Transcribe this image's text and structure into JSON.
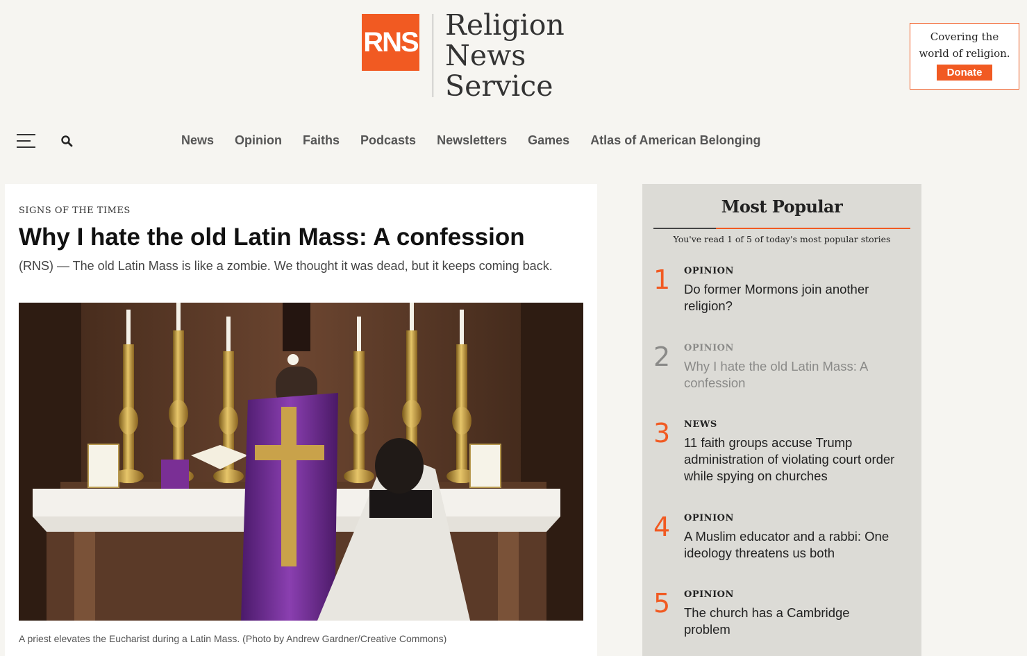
{
  "brand": {
    "logo_mark": "RNS",
    "name_lines": [
      "Religion",
      "News",
      "Service"
    ],
    "accent_color": "#f15a22"
  },
  "donate": {
    "tagline": "Covering the world of religion.",
    "button_label": "Donate"
  },
  "nav": {
    "menu_icon": "hamburger-menu-icon",
    "search_icon": "search-icon",
    "items": [
      "News",
      "Opinion",
      "Faiths",
      "Podcasts",
      "Newsletters",
      "Games",
      "Atlas of American Belonging"
    ]
  },
  "article": {
    "kicker": "Signs of the Times",
    "headline": "Why I hate the old Latin Mass: A confession",
    "dek": "(RNS) — The old Latin Mass is like a zombie. We thought it was dead, but it keeps coming back.",
    "caption": "A priest elevates the Eucharist during a Latin Mass. (Photo by Andrew Gardner/Creative Commons)"
  },
  "sidebar": {
    "title": "Most Popular",
    "subtitle": "You've read 1 of 5 of today's most popular stories",
    "items": [
      {
        "rank": "1",
        "category": "OPINION",
        "title": "Do former Mormons join another religion?"
      },
      {
        "rank": "2",
        "category": "OPINION",
        "title": "Why I hate the old Latin Mass: A confession"
      },
      {
        "rank": "3",
        "category": "NEWS",
        "title": "11 faith groups accuse Trump administration of violating court order while spying on churches"
      },
      {
        "rank": "4",
        "category": "OPINION",
        "title": "A Muslim educator and a rabbi: One ideology threatens us both"
      },
      {
        "rank": "5",
        "category": "OPINION",
        "title": "The church has a Cambridge problem"
      }
    ]
  }
}
